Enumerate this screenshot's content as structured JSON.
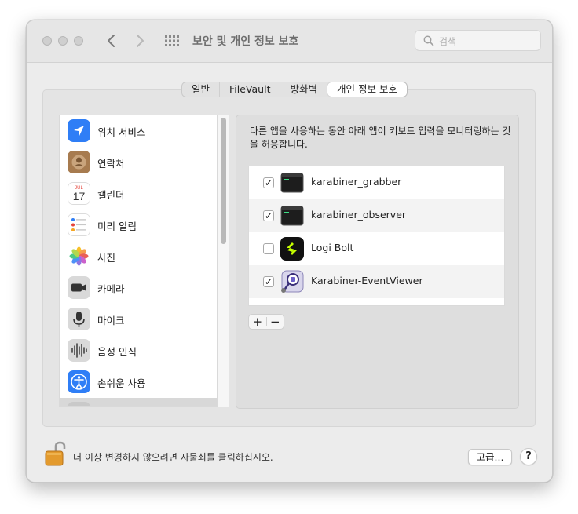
{
  "window": {
    "title": "보안 및 개인 정보 보호",
    "search": {
      "placeholder": "검색",
      "value": ""
    }
  },
  "tabs": [
    {
      "label": "일반",
      "active": false
    },
    {
      "label": "FileVault",
      "active": false
    },
    {
      "label": "방화벽",
      "active": false
    },
    {
      "label": "개인 정보 보호",
      "active": true
    }
  ],
  "sidebar": {
    "items": [
      {
        "label": "위치 서비스",
        "icon": "location-icon"
      },
      {
        "label": "연락처",
        "icon": "contacts-icon"
      },
      {
        "label": "캘린더",
        "icon": "calendar-icon",
        "calendar_month": "JUL",
        "calendar_day": "17"
      },
      {
        "label": "미리 알림",
        "icon": "reminders-icon"
      },
      {
        "label": "사진",
        "icon": "photos-icon"
      },
      {
        "label": "카메라",
        "icon": "camera-icon"
      },
      {
        "label": "마이크",
        "icon": "microphone-icon"
      },
      {
        "label": "음성 인식",
        "icon": "speech-recognition-icon"
      },
      {
        "label": "손쉬운 사용",
        "icon": "accessibility-icon"
      }
    ]
  },
  "main": {
    "description": "다른 앱을 사용하는 동안 아래 앱이 키보드 입력을 모니터링하는 것을 허용합니다.",
    "apps": [
      {
        "name": "karabiner_grabber",
        "checked": true,
        "icon": "terminal-icon"
      },
      {
        "name": "karabiner_observer",
        "checked": true,
        "icon": "terminal-icon"
      },
      {
        "name": "Logi Bolt",
        "checked": false,
        "icon": "logi-bolt-icon"
      },
      {
        "name": "Karabiner-EventViewer",
        "checked": true,
        "icon": "karabiner-eventviewer-icon"
      }
    ],
    "add_label": "+",
    "remove_label": "−"
  },
  "footer": {
    "lock_text": "더 이상 변경하지 않으려면 자물쇠를 클릭하십시오.",
    "advanced_label": "고급...",
    "help_label": "?"
  },
  "colors": {
    "accent_blue": "#2f7ef6",
    "logi_yellow": "#c6ff00",
    "checkbox_border": "#a8a8a8"
  }
}
